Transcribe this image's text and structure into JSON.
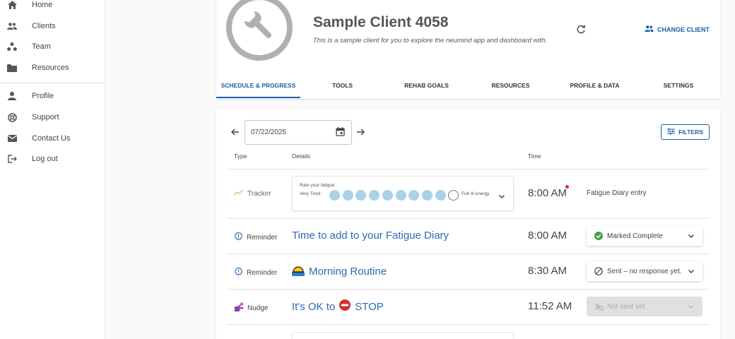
{
  "sidebar": {
    "items": [
      {
        "label": "Home",
        "icon": "home-icon"
      },
      {
        "label": "Clients",
        "icon": "people-icon"
      },
      {
        "label": "Team",
        "icon": "team-icon"
      },
      {
        "label": "Resources",
        "icon": "folder-icon"
      },
      {
        "label": "Profile",
        "icon": "person-icon"
      },
      {
        "label": "Support",
        "icon": "lifebuoy-icon"
      },
      {
        "label": "Contact Us",
        "icon": "mail-icon"
      },
      {
        "label": "Log out",
        "icon": "logout-icon"
      }
    ]
  },
  "client": {
    "name": "Sample Client 4058",
    "description": "This is a sample client for you to explore the neumind app and dashboard with.",
    "change_label": "CHANGE CLIENT"
  },
  "tabs": [
    {
      "label": "SCHEDULE & PROGRESS",
      "active": true
    },
    {
      "label": "TOOLS",
      "active": false
    },
    {
      "label": "REHAB GOALS",
      "active": false
    },
    {
      "label": "RESOURCES",
      "active": false
    },
    {
      "label": "PROFILE & DATA",
      "active": false
    },
    {
      "label": "SETTINGS",
      "active": false
    }
  ],
  "schedule": {
    "date": "07/22/2025",
    "filters_label": "FILTERS",
    "columns": {
      "type": "Type",
      "details": "Details",
      "time": "Time"
    },
    "tracker": {
      "type": "Tracker",
      "question": "Rate your fatigue",
      "low_label": "Very Tired",
      "high_label": "Full of energy",
      "rating": 9,
      "scale": 10,
      "time": "8:00 AM",
      "entry": "Fatigue Diary entry"
    },
    "rows": [
      {
        "type": "Reminder",
        "title": "Time to add to your Fatigue Diary",
        "time": "8:00 AM",
        "status": "Marked Complete"
      },
      {
        "type": "Reminder",
        "title": "Morning Routine",
        "time": "8:30 AM",
        "status": "Sent – no response yet."
      },
      {
        "type": "Nudge",
        "title_pre": "It's OK to",
        "title_post": "STOP",
        "time": "11:52 AM",
        "status": "Not sent yet."
      }
    ]
  },
  "colors": {
    "accent": "#1f5ea8",
    "link": "#2b6bb0",
    "scale_dot": "#a9d2e8",
    "complete": "#43a047"
  }
}
